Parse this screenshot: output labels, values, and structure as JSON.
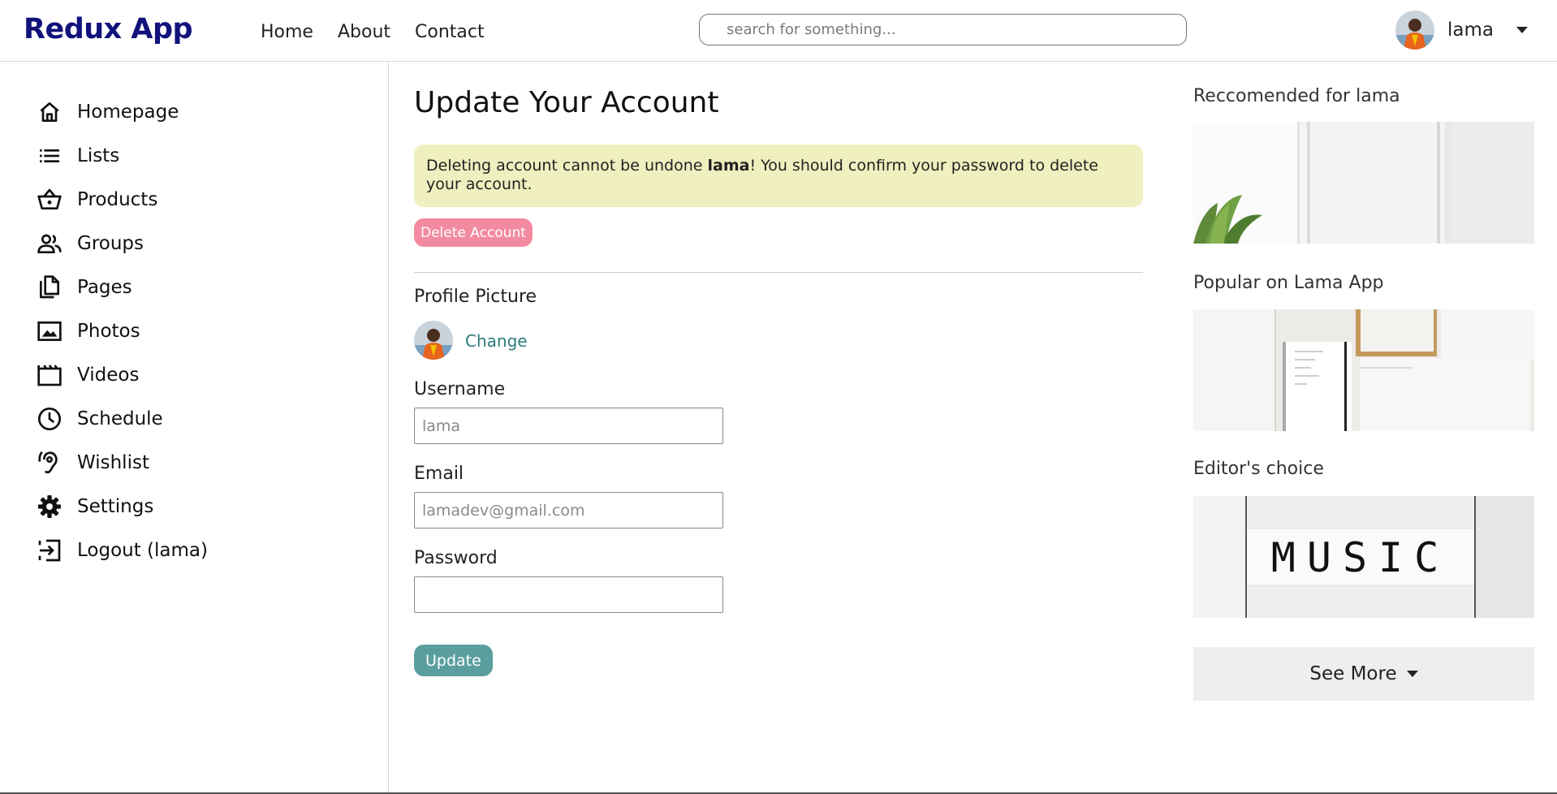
{
  "header": {
    "logo": "Redux App",
    "nav": [
      "Home",
      "About",
      "Contact"
    ],
    "search_placeholder": "search for something...",
    "username": "lama"
  },
  "sidebar": {
    "items": [
      {
        "label": "Homepage",
        "icon": "home-icon"
      },
      {
        "label": "Lists",
        "icon": "list-icon"
      },
      {
        "label": "Products",
        "icon": "basket-icon"
      },
      {
        "label": "Groups",
        "icon": "people-icon"
      },
      {
        "label": "Pages",
        "icon": "pages-icon"
      },
      {
        "label": "Photos",
        "icon": "photo-icon"
      },
      {
        "label": "Videos",
        "icon": "video-icon"
      },
      {
        "label": "Schedule",
        "icon": "clock-icon"
      },
      {
        "label": "Wishlist",
        "icon": "hearing-icon"
      },
      {
        "label": "Settings",
        "icon": "gear-icon"
      },
      {
        "label": "Logout (lama)",
        "icon": "logout-icon"
      }
    ]
  },
  "main": {
    "title": "Update Your Account",
    "alert": {
      "before": "Deleting account cannot be undone ",
      "name": "lama",
      "after": "! You should confirm your password to delete your account."
    },
    "delete_label": "Delete Account",
    "profile_picture_label": "Profile Picture",
    "change_label": "Change",
    "username_label": "Username",
    "username_placeholder": "lama",
    "email_label": "Email",
    "email_placeholder": "lamadev@gmail.com",
    "password_label": "Password",
    "password_value": "",
    "update_label": "Update"
  },
  "right": {
    "sections": [
      {
        "title": "Reccomended for lama"
      },
      {
        "title": "Popular on Lama App"
      },
      {
        "title": "Editor's choice",
        "image_text": "MUSIC"
      }
    ],
    "see_more_label": "See More"
  },
  "colors": {
    "logo": "#12127c",
    "alert_bg": "#efefbf",
    "delete_btn": "#f38ba0",
    "update_btn": "#5b9e9e",
    "link": "#2c7c7c",
    "see_more_bg": "#eeeeee"
  }
}
